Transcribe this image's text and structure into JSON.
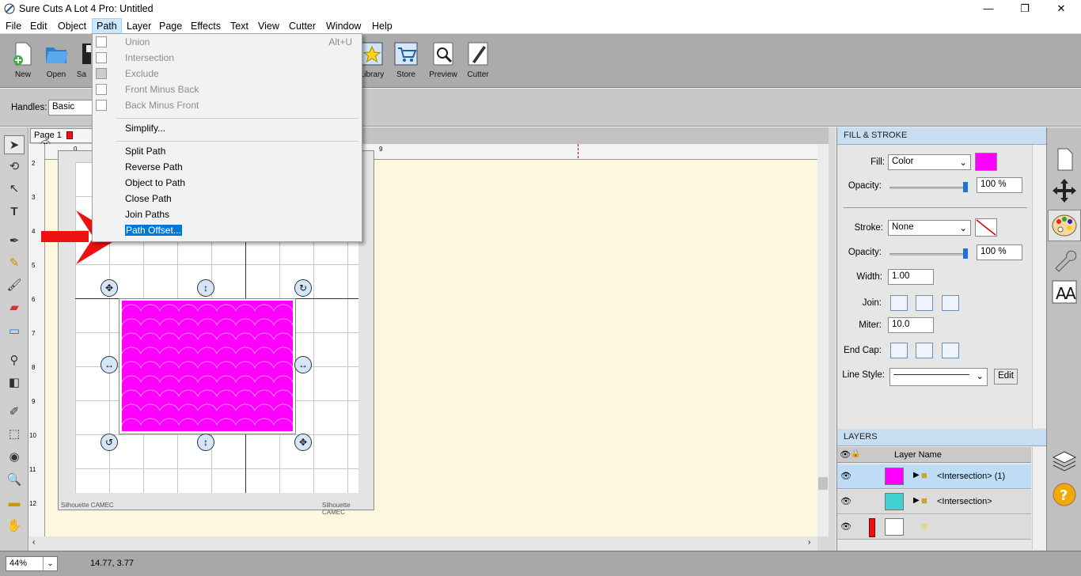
{
  "window": {
    "title": "Sure Cuts A Lot 4 Pro: Untitled",
    "minimize": "—",
    "maximize": "❐",
    "close": "✕"
  },
  "menubar": {
    "items": [
      "File",
      "Edit",
      "Object",
      "Path",
      "Layer",
      "Page",
      "Effects",
      "Text",
      "View",
      "Cutter",
      "Window",
      "Help"
    ],
    "active": "Path"
  },
  "toolbar": {
    "new": "New",
    "open": "Open",
    "save": "Sa",
    "library": "Library",
    "store": "Store",
    "preview": "Preview",
    "cutter": "Cutter"
  },
  "options": {
    "handles_label": "Handles:",
    "handles_value": "Basic"
  },
  "path_menu": {
    "union": "Union",
    "union_shortcut": "Alt+U",
    "intersection": "Intersection",
    "exclude": "Exclude",
    "front_minus_back": "Front Minus Back",
    "back_minus_front": "Back Minus Front",
    "simplify": "Simplify...",
    "split_path": "Split Path",
    "reverse_path": "Reverse Path",
    "object_to_path": "Object to Path",
    "close_path": "Close Path",
    "join_paths": "Join Paths",
    "path_offset": "Path Offset..."
  },
  "canvas": {
    "page_tab": "Page 1",
    "ruler_h": [
      "0",
      "9"
    ],
    "ruler_v": [
      "2",
      "3",
      "4",
      "5",
      "6",
      "7",
      "8",
      "9",
      "10",
      "11",
      "12"
    ],
    "mat_label_left": "Silhouette CAMEC",
    "mat_label_right": "Silhouette CAMEC"
  },
  "status": {
    "zoom": "44%",
    "coords": "14.77, 3.77"
  },
  "fill_stroke": {
    "header": "FILL & STROKE",
    "fill_label": "Fill:",
    "fill_value": "Color",
    "fill_color": "#ff00ff",
    "opacity_label": "Opacity:",
    "fill_opacity": "100 %",
    "fill_opacity_level": 1.0,
    "stroke_label": "Stroke:",
    "stroke_value": "None",
    "stroke_opacity_label": "Opacity:",
    "stroke_opacity": "100 %",
    "stroke_opacity_level": 1.0,
    "width_label": "Width:",
    "width_value": "1.00",
    "join_label": "Join:",
    "miter_label": "Miter:",
    "miter_value": "10.0",
    "endcap_label": "End Cap:",
    "linestyle_label": "Line Style:",
    "edit_button": "Edit"
  },
  "layers": {
    "header": "LAYERS",
    "column": "Layer Name",
    "rows": [
      {
        "name": "<Intersection> (1)",
        "swatch": "#ff00ff",
        "selected": true
      },
      {
        "name": "<Intersection>",
        "swatch": "#40d0d0",
        "selected": false
      },
      {
        "name": "",
        "swatch": "#ffffff",
        "selected": false
      }
    ]
  },
  "colors": {
    "accent": "#0078d7",
    "arrow": "#ee1111",
    "panel_header": "#c7def2"
  }
}
